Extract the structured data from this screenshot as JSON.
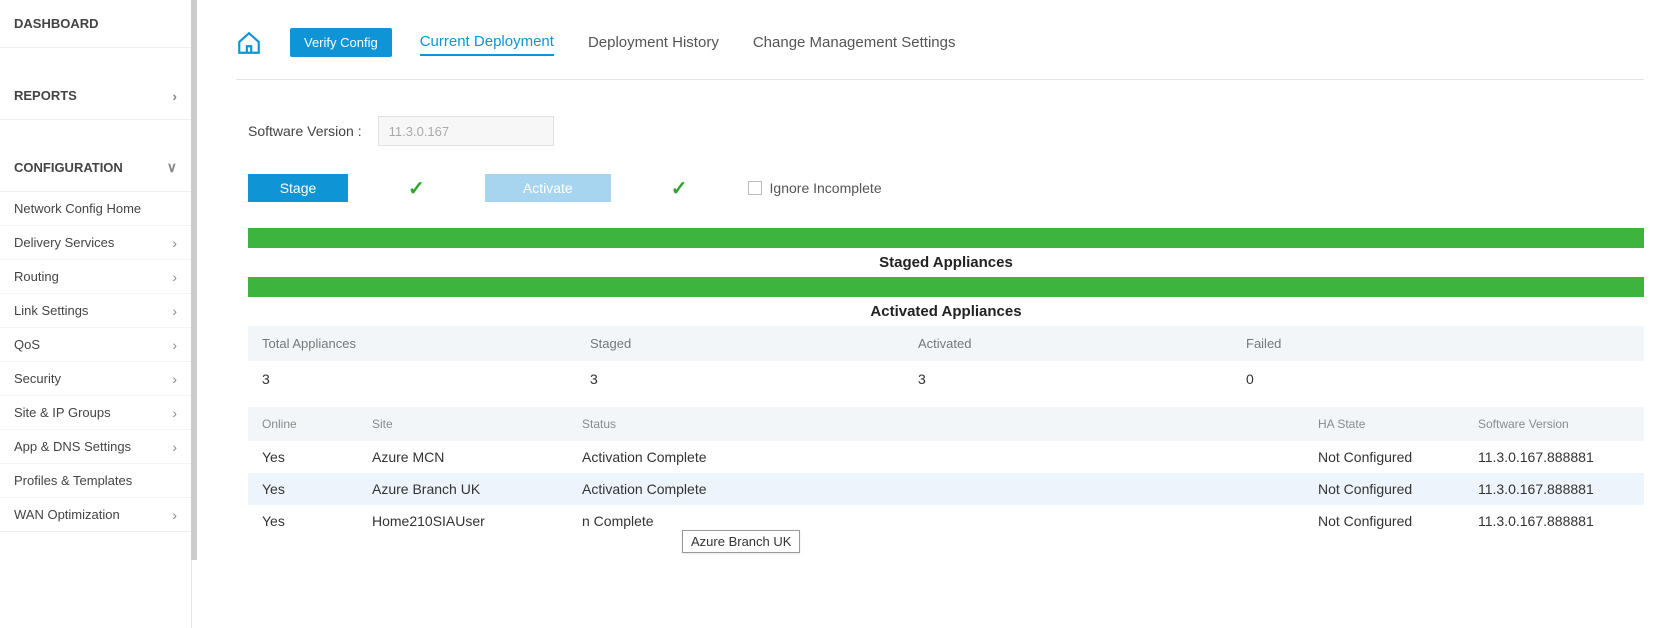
{
  "sidebar": {
    "dashboard": "DASHBOARD",
    "reports": "REPORTS",
    "configuration": "CONFIGURATION",
    "items": [
      "Network Config Home",
      "Delivery Services",
      "Routing",
      "Link Settings",
      "QoS",
      "Security",
      "Site & IP Groups",
      "App & DNS Settings",
      "Profiles & Templates",
      "WAN Optimization"
    ],
    "item_has_chevron": [
      false,
      true,
      true,
      true,
      true,
      true,
      true,
      true,
      false,
      true
    ]
  },
  "tabs": {
    "verify": "Verify Config",
    "current": "Current Deployment",
    "history": "Deployment History",
    "settings": "Change Management Settings"
  },
  "software": {
    "label": "Software Version :",
    "value": "11.3.0.167"
  },
  "actions": {
    "stage": "Stage",
    "activate": "Activate",
    "ignore": "Ignore Incomplete"
  },
  "sections": {
    "staged": "Staged Appliances",
    "activated": "Activated Appliances"
  },
  "summary": {
    "headers": [
      "Total Appliances",
      "Staged",
      "Activated",
      "Failed"
    ],
    "values": [
      "3",
      "3",
      "3",
      "0"
    ]
  },
  "sites": {
    "headers": [
      "Online",
      "Site",
      "Status",
      "HA State",
      "Software Version"
    ],
    "rows": [
      {
        "online": "Yes",
        "site": "Azure MCN",
        "status": "Activation Complete",
        "ha": "Not Configured",
        "ver": "11.3.0.167.888881"
      },
      {
        "online": "Yes",
        "site": "Azure Branch UK",
        "status": "Activation Complete",
        "ha": "Not Configured",
        "ver": "11.3.0.167.888881"
      },
      {
        "online": "Yes",
        "site": "Home210SIAUser",
        "status": "n Complete",
        "ha": "Not Configured",
        "ver": "11.3.0.167.888881"
      }
    ]
  },
  "tooltip": "Azure Branch UK"
}
